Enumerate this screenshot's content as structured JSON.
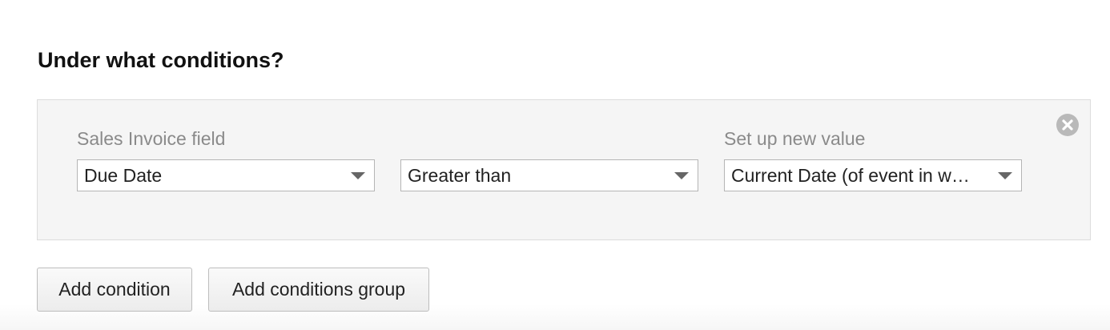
{
  "section": {
    "title": "Under what conditions?"
  },
  "condition": {
    "field_label": "Sales Invoice field",
    "field_value": "Due Date",
    "operator_value": "Greater than",
    "value_label": "Set up new value",
    "value_value": "Current Date (of event in w…",
    "remove_icon": "close-circle-icon"
  },
  "actions": {
    "add_condition": "Add condition",
    "add_group": "Add conditions group"
  },
  "colors": {
    "panel_bg": "#f5f5f5",
    "label_gray": "#8a8a8a",
    "remove_icon_gray": "#b9b9b9"
  }
}
